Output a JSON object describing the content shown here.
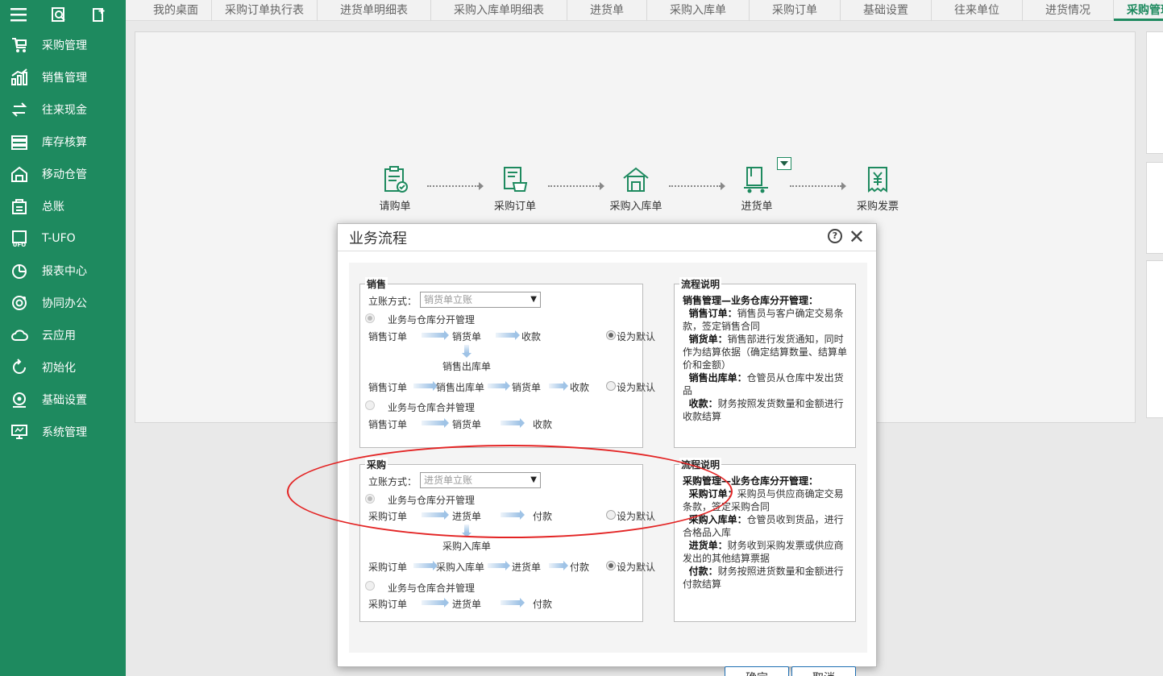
{
  "sidebar": {
    "items": [
      {
        "label": "采购管理",
        "icon": "cart-icon"
      },
      {
        "label": "销售管理",
        "icon": "chart-icon"
      },
      {
        "label": "往来现金",
        "icon": "exchange-icon"
      },
      {
        "label": "库存核算",
        "icon": "stack-icon"
      },
      {
        "label": "移动仓管",
        "icon": "warehouse-icon"
      },
      {
        "label": "总账",
        "icon": "ledger-icon"
      },
      {
        "label": "T-UFO",
        "icon": "ufo-icon"
      },
      {
        "label": "报表中心",
        "icon": "pie-icon"
      },
      {
        "label": "协同办公",
        "icon": "target-icon"
      },
      {
        "label": "云应用",
        "icon": "cloud-icon"
      },
      {
        "label": "初始化",
        "icon": "refresh-icon"
      },
      {
        "label": "基础设置",
        "icon": "settings-icon"
      },
      {
        "label": "系统管理",
        "icon": "monitor-icon"
      }
    ]
  },
  "tabs": [
    {
      "label": "我的桌面"
    },
    {
      "label": "采购订单执行表"
    },
    {
      "label": "进货单明细表"
    },
    {
      "label": "采购入库单明细表"
    },
    {
      "label": "进货单"
    },
    {
      "label": "采购入库单"
    },
    {
      "label": "采购订单"
    },
    {
      "label": "基础设置"
    },
    {
      "label": "往来单位"
    },
    {
      "label": "进货情况"
    },
    {
      "label": "采购管理",
      "active": true,
      "close": "✕"
    }
  ],
  "flow": {
    "nodes": [
      {
        "label": "请购单"
      },
      {
        "label": "采购订单"
      },
      {
        "label": "采购入库单"
      },
      {
        "label": "进货单"
      },
      {
        "label": "采购发票"
      }
    ]
  },
  "dialog": {
    "title": "业务流程",
    "help": "?",
    "close": "✕",
    "ok": "确定",
    "cancel": "取消",
    "sales": {
      "title": "销售",
      "method_label": "立账方式：",
      "method_value": "销货单立账",
      "opt1": "业务与仓库分开管理",
      "opt2": "业务与仓库合并管理",
      "set_default": "设为默认",
      "row1": [
        "销售订单",
        "销货单",
        "收款"
      ],
      "mid": "销售出库单",
      "row2": [
        "销售订单",
        "销售出库单",
        "销货单",
        "收款"
      ],
      "row3": [
        "销售订单",
        "销货单",
        "收款"
      ]
    },
    "sales_desc": {
      "title": "流程说明",
      "head": "销售管理—业务仓库分开管理：",
      "items": [
        {
          "k": "销售订单：",
          "v": "销售员与客户确定交易条款，签定销售合同"
        },
        {
          "k": "销货单：",
          "v": "销售部进行发货通知，同时作为结算依据（确定结算数量、结算单价和金额）"
        },
        {
          "k": "销售出库单：",
          "v": "仓管员从仓库中发出货品"
        },
        {
          "k": "收款：",
          "v": "财务按照发货数量和金额进行收款结算"
        }
      ]
    },
    "purchase": {
      "title": "采购",
      "method_label": "立账方式：",
      "method_value": "进货单立账",
      "opt1": "业务与仓库分开管理",
      "opt2": "业务与仓库合并管理",
      "set_default": "设为默认",
      "row1": [
        "采购订单",
        "进货单",
        "付款"
      ],
      "mid": "采购入库单",
      "row2": [
        "采购订单",
        "采购入库单",
        "进货单",
        "付款"
      ],
      "row3": [
        "采购订单",
        "进货单",
        "付款"
      ]
    },
    "purchase_desc": {
      "title": "流程说明",
      "head": "采购管理—业务仓库分开管理：",
      "items": [
        {
          "k": "采购订单：",
          "v": "采购员与供应商确定交易条款，签定采购合同"
        },
        {
          "k": "采购入库单：",
          "v": "仓管员收到货品，进行合格品入库"
        },
        {
          "k": "进货单：",
          "v": "财务收到采购发票或供应商发出的其他结算票据"
        },
        {
          "k": "付款：",
          "v": "财务按照进货数量和金额进行付款结算"
        }
      ]
    }
  },
  "colors": {
    "brand": "#1e8a5f",
    "highlight": "#e32424"
  }
}
